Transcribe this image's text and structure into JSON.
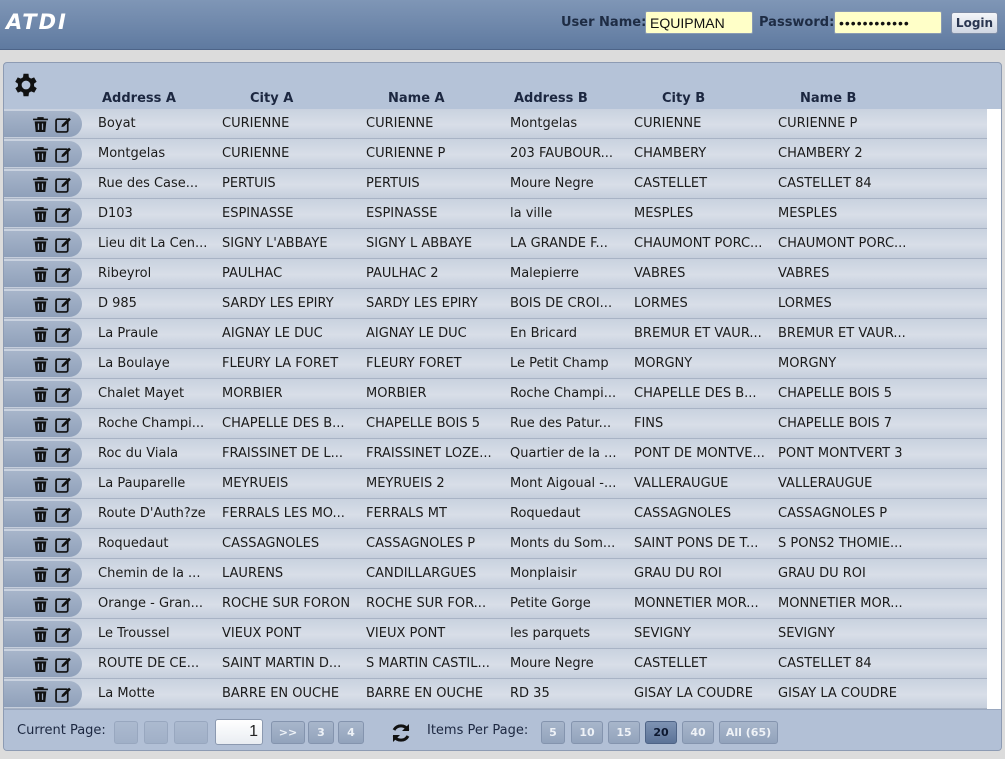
{
  "header": {
    "logo": "ATDI",
    "username_label": "User Name:",
    "username_value": "EQUIPMAN",
    "password_label": "Password:",
    "password_value": "••••••••••••",
    "login_label": "Login"
  },
  "columns": [
    "Address A",
    "City A",
    "Name A",
    "Address B",
    "City B",
    "Name B"
  ],
  "rows": [
    [
      "Boyat",
      "CURIENNE",
      "CURIENNE",
      "Montgelas",
      "CURIENNE",
      "CURIENNE P"
    ],
    [
      "Montgelas",
      "CURIENNE",
      "CURIENNE P",
      "203 FAUBOUR...",
      "CHAMBERY",
      "CHAMBERY 2"
    ],
    [
      "Rue des Case...",
      "PERTUIS",
      "PERTUIS",
      "Moure Negre",
      "CASTELLET",
      "CASTELLET 84"
    ],
    [
      "D103",
      "ESPINASSE",
      "ESPINASSE",
      "la ville",
      "MESPLES",
      "MESPLES"
    ],
    [
      "Lieu dit La Cen...",
      "SIGNY L'ABBAYE",
      "SIGNY L ABBAYE",
      "LA GRANDE F...",
      "CHAUMONT PORC...",
      "CHAUMONT PORC..."
    ],
    [
      "Ribeyrol",
      "PAULHAC",
      "PAULHAC 2",
      "Malepierre",
      "VABRES",
      "VABRES"
    ],
    [
      "D 985",
      "SARDY LES EPIRY",
      "SARDY LES EPIRY",
      "BOIS DE CROI...",
      "LORMES",
      "LORMES"
    ],
    [
      "La Praule",
      "AIGNAY LE DUC",
      "AIGNAY LE DUC",
      "En Bricard",
      "BREMUR ET VAUR...",
      "BREMUR ET VAUR..."
    ],
    [
      "La Boulaye",
      "FLEURY LA FORET",
      "FLEURY FORET",
      "Le Petit Champ",
      "MORGNY",
      "MORGNY"
    ],
    [
      "Chalet Mayet",
      "MORBIER",
      "MORBIER",
      "Roche Champi...",
      "CHAPELLE DES B...",
      "CHAPELLE BOIS 5"
    ],
    [
      "Roche Champi...",
      "CHAPELLE DES B...",
      "CHAPELLE BOIS 5",
      "Rue des Patur...",
      "FINS",
      "CHAPELLE BOIS 7"
    ],
    [
      "Roc du Viala",
      "FRAISSINET DE L...",
      "FRAISSINET LOZE...",
      "Quartier de la ...",
      "PONT DE MONTVE...",
      "PONT MONTVERT 3"
    ],
    [
      "La Pauparelle",
      "MEYRUEIS",
      "MEYRUEIS 2",
      "Mont Aigoual -...",
      "VALLERAUGUE",
      "VALLERAUGUE"
    ],
    [
      "Route D'Auth?ze",
      "FERRALS LES MO...",
      "FERRALS MT",
      "Roquedaut",
      "CASSAGNOLES",
      "CASSAGNOLES P"
    ],
    [
      "Roquedaut",
      "CASSAGNOLES",
      "CASSAGNOLES P",
      "Monts du Som...",
      "SAINT PONS DE T...",
      "S PONS2 THOMIE..."
    ],
    [
      "Chemin de la ...",
      "LAURENS",
      "CANDILLARGUES",
      "Monplaisir",
      "GRAU DU ROI",
      "GRAU DU ROI"
    ],
    [
      "Orange - Gran...",
      "ROCHE SUR FORON",
      "ROCHE SUR FOR...",
      "Petite Gorge",
      "MONNETIER MOR...",
      "MONNETIER MOR..."
    ],
    [
      "Le Troussel",
      "VIEUX PONT",
      "VIEUX PONT",
      "les parquets",
      "SEVIGNY",
      "SEVIGNY"
    ],
    [
      "ROUTE DE CE...",
      "SAINT MARTIN D...",
      "S MARTIN CASTIL...",
      "Moure Negre",
      "CASTELLET",
      "CASTELLET 84"
    ],
    [
      "La Motte",
      "BARRE EN OUCHE",
      "BARRE EN OUCHE",
      "RD 35",
      "GISAY LA COUDRE",
      "GISAY LA COUDRE"
    ]
  ],
  "footer": {
    "current_page_label": "Current Page:",
    "current_page": "1",
    "page_buttons": [
      ">>",
      "3",
      "4"
    ],
    "items_per_page_label": "Items Per Page:",
    "items_per_page_options": [
      "5",
      "10",
      "15",
      "20",
      "40",
      "All (65)"
    ],
    "items_per_page_selected": "20"
  },
  "colors": {
    "header_bg": "#6f88ad",
    "panel_bg": "#b5c3d8",
    "input_bg": "#ffffc8"
  }
}
